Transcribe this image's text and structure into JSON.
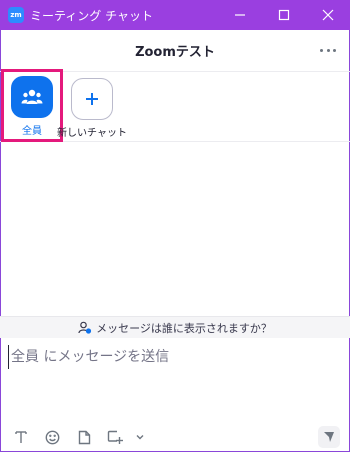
{
  "window": {
    "app_logo_text": "zm",
    "title": "ミーティング チャット",
    "controls": [
      "minimize-icon",
      "maximize-icon",
      "close-icon"
    ]
  },
  "header": {
    "title": "Zoomテスト",
    "more_icon": "ellipsis-icon"
  },
  "participants": [
    {
      "label": "全員",
      "icon": "people-icon",
      "selected": true
    },
    {
      "label": "新しいチャット",
      "icon": "plus-icon",
      "selected": false
    }
  ],
  "notice": {
    "icon": "person-visibility-icon",
    "text": "メッセージは誰に表示されますか？"
  },
  "compose": {
    "placeholder": "全員 にメッセージを送信",
    "value": ""
  },
  "toolbar": {
    "tools": [
      "text-format-icon",
      "emoji-icon",
      "file-icon",
      "screenshot-icon",
      "chevron-down-icon"
    ],
    "send_icon": "send-icon"
  },
  "colors": {
    "titlebar": "#9a3fe0",
    "accent": "#0e72ed",
    "highlight": "#e4197c"
  }
}
